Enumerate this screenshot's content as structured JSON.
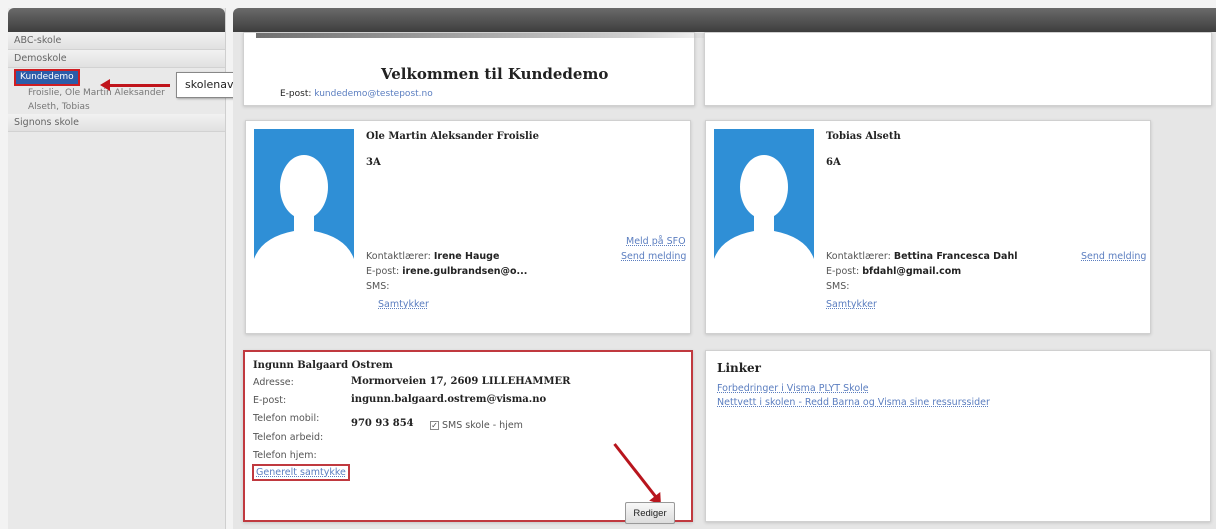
{
  "sidebar": {
    "items": [
      {
        "label": "ABC-skole"
      },
      {
        "label": "Demoskole"
      },
      {
        "label": "Kundedemo"
      },
      {
        "label": "Signons skole"
      }
    ],
    "sub_items": [
      {
        "label": "Froislie, Ole Martin Aleksander"
      },
      {
        "label": "Alseth, Tobias"
      }
    ],
    "tooltip": "skolenavn"
  },
  "welcome": {
    "title": "Velkommen til Kundedemo",
    "email_prefix": "E-post:",
    "email": "kundedemo@testepost.no"
  },
  "students": [
    {
      "name": "Ole Martin Aleksander Froislie",
      "class": "3A",
      "teacher_label": "Kontaktlærer:",
      "teacher": "Irene Hauge",
      "email_label": "E-post:",
      "email": "irene.gulbrandsen@o...",
      "sms_label": "SMS:",
      "consent_link": "Samtykker",
      "report_link": "Meld på SFO",
      "message_link": "Send melding"
    },
    {
      "name": "Tobias Alseth",
      "class": "6A",
      "teacher_label": "Kontaktlærer:",
      "teacher": "Bettina Francesca Dahl",
      "email_label": "E-post:",
      "email": "bfdahl@gmail.com",
      "sms_label": "SMS:",
      "consent_link": "Samtykker",
      "message_link": "Send melding"
    }
  ],
  "contact": {
    "name": "Ingunn Balgaard Ostrem",
    "address_label": "Adresse:",
    "address": "Mormorveien 17, 2609 LILLEHAMMER",
    "email_label": "E-post:",
    "email": "ingunn.balgaard.ostrem@visma.no",
    "mobile_label": "Telefon mobil:",
    "mobile": "970 93 854",
    "sms_option": "SMS skole - hjem",
    "work_label": "Telefon arbeid:",
    "home_label": "Telefon hjem:",
    "general_consent": "Generelt samtykke",
    "edit_button": "Rediger"
  },
  "links": {
    "title": "Linker",
    "items": [
      "Forbedringer i Visma PLYT Skole",
      "Nettvett i skolen - Redd Barna og Visma sine ressurssider"
    ]
  },
  "colors": {
    "accent": "#2d5ca8",
    "highlight": "#c0393f",
    "link": "#5b7ec0",
    "avatar": "#2f8fd6"
  }
}
